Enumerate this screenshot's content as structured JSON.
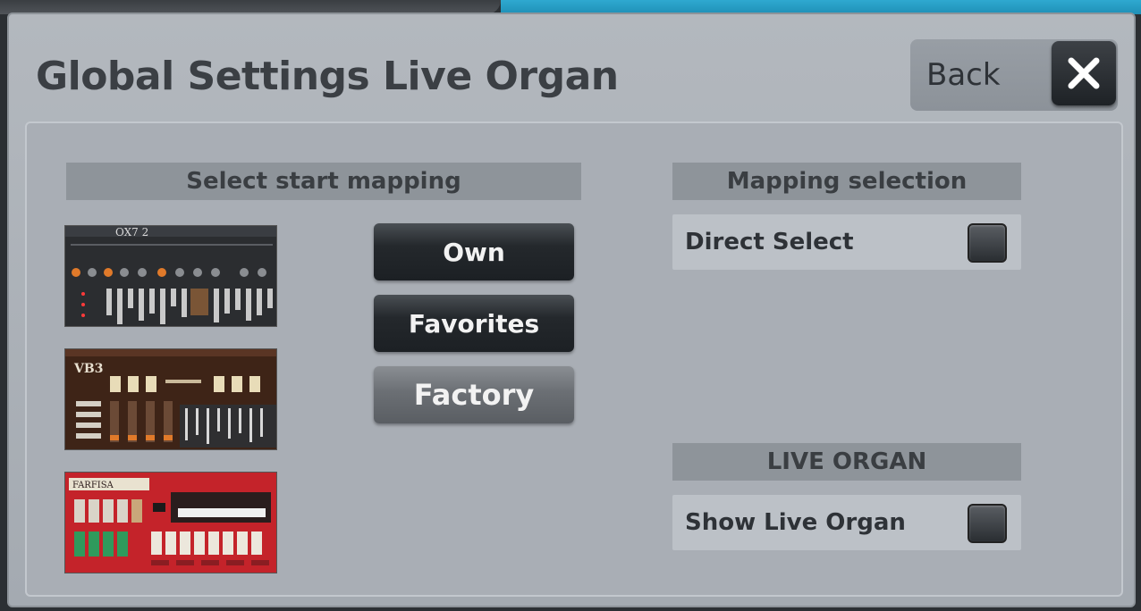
{
  "dialog": {
    "title": "Global Settings Live Organ",
    "back_label": "Back"
  },
  "start_mapping": {
    "header": "Select start mapping",
    "thumbnails": [
      {
        "name": "OX7",
        "logo": "OX7 2"
      },
      {
        "name": "VB3",
        "logo": "VB3"
      },
      {
        "name": "Farfisa",
        "logo": "FARFISA"
      }
    ],
    "buttons": [
      {
        "label": "Own",
        "active": false
      },
      {
        "label": "Favorites",
        "active": false
      },
      {
        "label": "Factory",
        "active": true
      }
    ]
  },
  "mapping_selection": {
    "header": "Mapping selection",
    "direct_select_label": "Direct Select",
    "direct_select_checked": false
  },
  "live_organ": {
    "header": "LIVE ORGAN",
    "show_label": "Show Live Organ",
    "show_checked": false
  },
  "colors": {
    "dialog_bg": "#a9aeb5",
    "header_bg": "#8e949a",
    "button_dark": "#24282c",
    "button_active": "#6b6f74",
    "accent_top": "#1f8fb6"
  }
}
